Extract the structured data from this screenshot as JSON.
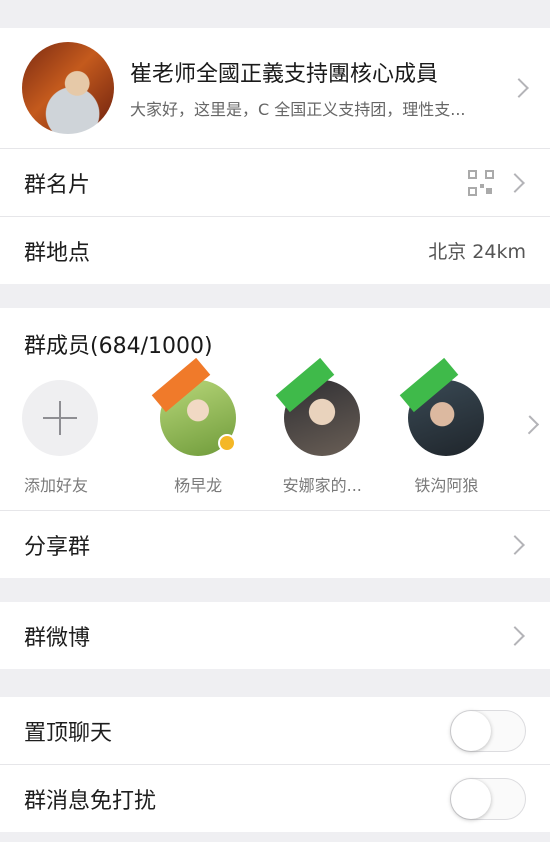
{
  "group": {
    "name": "崔老师全國正義支持團核心成員",
    "description": "大家好，这里是，C 全国正义支持团，理性支..."
  },
  "rows_top": [
    {
      "label": "群名片",
      "value": "",
      "has_qr": true
    },
    {
      "label": "群地点",
      "value": "北京 24km",
      "has_qr": false
    }
  ],
  "members": {
    "title": "群成员(684/1000)",
    "items": [
      {
        "name": "添加好友",
        "type": "add"
      },
      {
        "name": "杨早龙",
        "ribbon": "#f07a2a",
        "crown": true
      },
      {
        "name": "安娜家的...",
        "ribbon": "#3fba4a"
      },
      {
        "name": "铁沟阿狼",
        "ribbon": "#3fba4a"
      }
    ]
  },
  "share": {
    "label": "分享群"
  },
  "weibo": {
    "label": "群微博"
  },
  "toggles": [
    {
      "label": "置顶聊天",
      "on": false
    },
    {
      "label": "群消息免打扰",
      "on": false
    }
  ],
  "colors": {
    "accent_green": "#3fba4a",
    "accent_orange": "#f07a2a",
    "background": "#efeff2"
  }
}
